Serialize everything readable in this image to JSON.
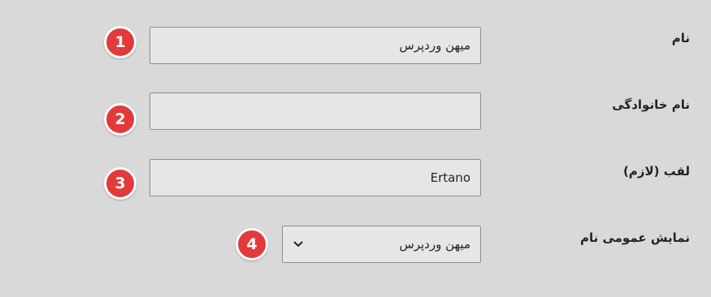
{
  "rows": [
    {
      "label": "نام",
      "value": "میهن وردپرس",
      "badge": "1"
    },
    {
      "label": "نام خانوادگی",
      "value": "",
      "badge": "2"
    },
    {
      "label": "لقب (لازم)",
      "value": "Ertano",
      "badge": "3"
    },
    {
      "label": "نمایش عمومی نام",
      "value": "میهن وردپرس",
      "badge": "4"
    }
  ],
  "select": {
    "icon": "chevron-down-icon"
  },
  "colors": {
    "background": "#d9d9d9",
    "field_bg": "#e6e6e6",
    "badge": "#e23a3a"
  }
}
